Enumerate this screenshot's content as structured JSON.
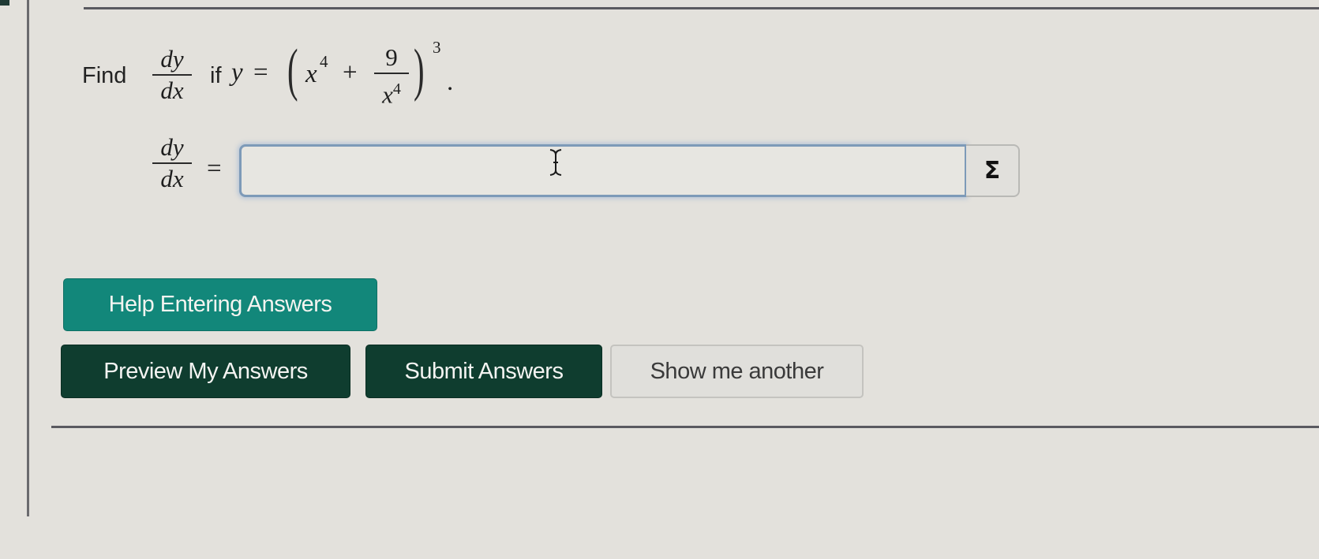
{
  "problem": {
    "prefix": "Find",
    "derivative": {
      "numerator": "dy",
      "denominator": "dx"
    },
    "condition_word": "if",
    "equation": {
      "lhs": "y",
      "equals": "=",
      "open_paren": "(",
      "term1_base": "x",
      "term1_exp": "4",
      "plus": "+",
      "frac_numerator": "9",
      "frac_denominator_base": "x",
      "frac_denominator_exp": "4",
      "close_paren": ")",
      "outer_exp": "3",
      "period": "."
    }
  },
  "answer": {
    "label": {
      "numerator": "dy",
      "denominator": "dx"
    },
    "equals": "=",
    "input_value": "",
    "input_placeholder": "",
    "equation_editor_label": "Σ"
  },
  "buttons": {
    "help": "Help Entering Answers",
    "preview": "Preview My Answers",
    "submit": "Submit Answers",
    "another": "Show me another"
  },
  "colors": {
    "help_button": "#12877a",
    "primary_button": "#0f3d2f",
    "secondary_button": "#e0dfdb",
    "input_focus_border": "#7d9ab8"
  }
}
